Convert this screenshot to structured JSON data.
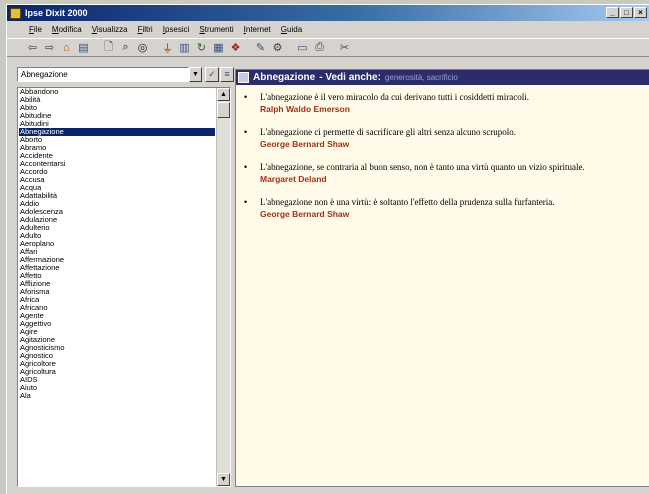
{
  "window": {
    "title": "Ipse Dixit 2000"
  },
  "menu": [
    "File",
    "Modifica",
    "Visualizza",
    "Filtri",
    "Ipsesici",
    "Strumenti",
    "Internet",
    "Guida"
  ],
  "search": {
    "value": "Abnegazione"
  },
  "words": [
    "Abbandono",
    "Abilità",
    "Abito",
    "Abitudine",
    "Abitudini",
    "Abnegazione",
    "Aborto",
    "Abramo",
    "Accidente",
    "Accontentarsi",
    "Accordo",
    "Accusa",
    "Acqua",
    "Adattabilità",
    "Addio",
    "Adolescenza",
    "Adulazione",
    "Adulterio",
    "Adulto",
    "Aeroplano",
    "Affari",
    "Affermazione",
    "Affettazione",
    "Affetto",
    "Afflizione",
    "Aforisma",
    "Africa",
    "Africano",
    "Agente",
    "Aggettivo",
    "Agire",
    "Agitazione",
    "Agnosticismo",
    "Agnostico",
    "Agricoltore",
    "Agricoltura",
    "AIDS",
    "Aiuto",
    "Ala"
  ],
  "selected_word": "Abnegazione",
  "header": {
    "term": "Abnegazione",
    "see_also_label": "- Vedi anche:",
    "related": "generosità, sacrificio"
  },
  "quotes": [
    {
      "text": "L'abnegazione è il vero miracolo da cui derivano tutti i cosiddetti miracoli.",
      "author": "Ralph Waldo Emerson"
    },
    {
      "text": "L'abnegazione ci permette di sacrificare gli altri senza alcuno scrupolo.",
      "author": "George Bernard Shaw"
    },
    {
      "text": "L'abnegazione, se contraria al buon senso, non è tanto una virtù quanto un vizio spirituale.",
      "author": "Margaret Deland"
    },
    {
      "text": "L'abnegazione non è una virtù: è soltanto l'effetto della prudenza sulla furfanteria.",
      "author": "George Bernard Shaw"
    }
  ],
  "colors": {
    "title_bar": "#0a246a",
    "selection": "#0a246a",
    "author": "#a0301c",
    "content_bg": "#fffbe8"
  }
}
